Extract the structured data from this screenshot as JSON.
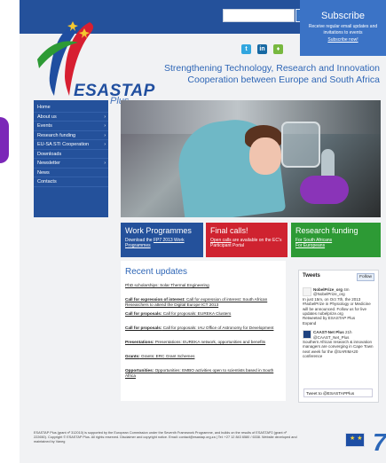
{
  "header": {
    "search": {
      "value": "",
      "placeholder": "",
      "icon": "search-icon"
    },
    "subscribe": {
      "title": "Subscribe",
      "description": "Receive regular email updates and invitations to events",
      "link": "Subscribe now!"
    },
    "logo_text": "ESASTAP",
    "logo_subtext": "Plus",
    "social": [
      {
        "name": "twitter",
        "label": "t"
      },
      {
        "name": "linkedin",
        "label": "in"
      },
      {
        "name": "rss",
        "label": "♦"
      }
    ],
    "tagline_line1": "Strengthening Technology, Research and Innovation",
    "tagline_line2": "Cooperation between Europe and South Africa"
  },
  "navigation": {
    "items": [
      {
        "label": "Home",
        "caret": ""
      },
      {
        "label": "About us",
        "caret": "›"
      },
      {
        "label": "Events",
        "caret": "›"
      },
      {
        "label": "Research funding",
        "caret": "›"
      },
      {
        "label": "EU-SA STI Cooperation",
        "caret": "›"
      },
      {
        "label": "Downloads",
        "caret": ""
      },
      {
        "label": "Newsletter",
        "caret": "›"
      },
      {
        "label": "News",
        "caret": ""
      },
      {
        "label": "Contacts",
        "caret": ""
      }
    ]
  },
  "feature_boxes": {
    "work": {
      "title": "Work Programmes",
      "text_prefix": "Download the ",
      "link": "FP7 2013 Work Programmes"
    },
    "calls": {
      "title": "Final calls!",
      "link": "Open calls",
      "text": " are available on the EC's Participant Portal"
    },
    "research": {
      "title": "Research funding",
      "link1": "For South Africans",
      "link2": "For Europeans"
    }
  },
  "updates": {
    "title": "Recent updates",
    "items": [
      {
        "label": "PhD scholarships: Solar Thermal Engineering",
        "bold": ""
      },
      {
        "label": " Call for expression of interest: South African Researchers to attend the Digital Europe ICT 2013",
        "bold": "Call for expression of interest:"
      },
      {
        "label": " Call for proposals: EUREKA Clusters",
        "bold": "Call for proposals:"
      },
      {
        "label": " Call for proposals: IAU Office of Astronomy for Development",
        "bold": "Call for proposals:"
      },
      {
        "label": " Presentations: EUREKA network, opportunities and benefits",
        "bold": "Presentations:"
      },
      {
        "label": " Grants: ERC Grant Schemes",
        "bold": "Grants:"
      },
      {
        "label": " Opportunities: EMBO activities open to scientists based in South Africa",
        "bold": "Opportunities:"
      }
    ]
  },
  "tweets": {
    "title": "Tweets",
    "follow": "Follow",
    "items": [
      {
        "name": "NobelPrize_org",
        "handle": "@NobelPrize_org",
        "time": "4m",
        "text": "In just 15m, on Oct 7th, the 2013 #NobelPrize in Physiology or Medicine will be announced. Follow us for live updates nobelprize.org",
        "retweet": "Retweeted by ESASTAP Plus",
        "expand": "Expand"
      },
      {
        "name": "CAAST-Net Plus",
        "handle": "@CAAST_Net_Plus",
        "time": "21h",
        "text": "Southern African research & innovation managers are converging in Cape Town next week for the @SARIMA20 conference",
        "retweet": "",
        "expand": ""
      }
    ],
    "compose": "Tweet to @ESASTAPPlus"
  },
  "footer": {
    "text": "ESASTAP Plus (grant nº 312010) is supported by the European Commission under the Seventh Framework Programme, and builds on the results of ESASTAP2 (grant nº 222650). Copyright © ESASTAP Plus. All rights reserved. Disclaimer and copyright notice. Email: contact@esastap.org.za | Tel: +27 12 843 6580 / 6338. Website developed and maintained by Vaneg",
    "eu_logo": "★ ★",
    "fp7_logo": "7"
  }
}
